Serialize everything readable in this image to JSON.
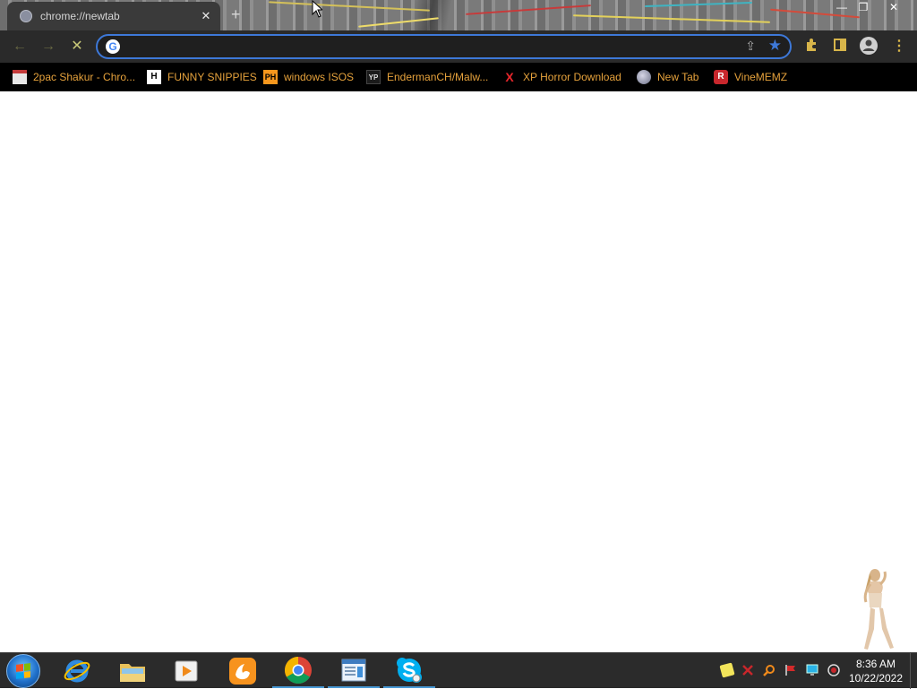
{
  "browser": {
    "tab_title": "chrome://newtab",
    "tab_close": "✕",
    "new_tab": "+",
    "window_controls": {
      "minimize": "—",
      "restore": "❐",
      "close": "✕"
    },
    "toolbar": {
      "back_icon": "←",
      "forward_icon": "→",
      "stop_icon": "✕",
      "address_value": "",
      "search_engine_icon": "G",
      "share_icon": "⇪",
      "bookmark_star_icon": "★"
    },
    "accent_color": "#3d78d8",
    "bookmarks": [
      {
        "label": "2pac Shakur - Chro...",
        "icon": "calendar-icon"
      },
      {
        "label": "FUNNY SNIPPIES",
        "icon": "H"
      },
      {
        "label": "windows ISOS",
        "icon": "PH"
      },
      {
        "label": "EndermanCH/Malw...",
        "icon": "YP"
      },
      {
        "label": "XP Horror Download",
        "icon": "X"
      },
      {
        "label": "New Tab",
        "icon": "globe-icon"
      },
      {
        "label": "VineMEMZ",
        "icon": "R"
      }
    ],
    "bookmark_text_color": "#e6a23c"
  },
  "taskbar": {
    "apps": [
      "start-orb",
      "internet-explorer",
      "file-explorer",
      "media-player",
      "uc-browser",
      "chrome",
      "notepad",
      "skype"
    ],
    "clock": {
      "time": "8:36 AM",
      "date": "10/22/2022"
    }
  }
}
